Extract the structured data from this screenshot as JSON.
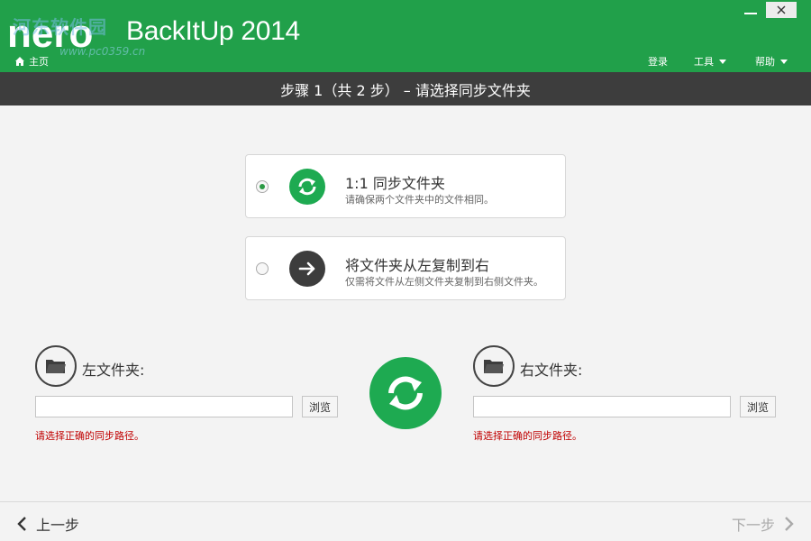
{
  "header": {
    "brand": "BackItUp 2014",
    "watermark": "河东软件园",
    "watermark_url": "www.pc0359.cn",
    "home_label": "主页",
    "menu": {
      "login": "登录",
      "tools": "工具",
      "help": "帮助"
    }
  },
  "step": {
    "title": "步骤 1（共 2 步） – 请选择同步文件夹"
  },
  "options": [
    {
      "title": "1:1 同步文件夹",
      "desc": "请确保两个文件夹中的文件相同。",
      "selected": true
    },
    {
      "title": "将文件夹从左复制到右",
      "desc": "仅需将文件从左侧文件夹复制到右侧文件夹。",
      "selected": false
    }
  ],
  "left_folder": {
    "label": "左文件夹:",
    "path": "",
    "browse_label": "浏览",
    "error": "请选择正确的同步路径。"
  },
  "right_folder": {
    "label": "右文件夹:",
    "path": "",
    "browse_label": "浏览",
    "error": "请选择正确的同步路径。"
  },
  "footer": {
    "prev_label": "上一步",
    "next_label": "下一步"
  },
  "colors": {
    "header_green": "#21a04a",
    "sync_green": "#1eaa51",
    "step_bar": "#3d3d3d",
    "error_red": "#c00000"
  }
}
